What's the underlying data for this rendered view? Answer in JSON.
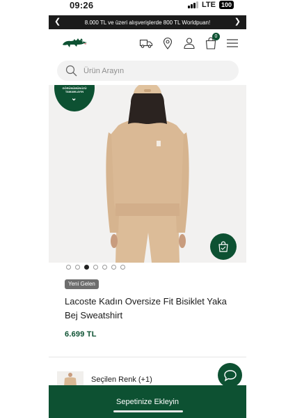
{
  "status_bar": {
    "time": "09:26",
    "network": "LTE",
    "battery": "100"
  },
  "announcement": {
    "text": "8.000 TL ve üzeri alışverişlerde 800 TL Worldpuan!",
    "prev_icon": "chevron-left-icon",
    "next_icon": "chevron-right-icon"
  },
  "header": {
    "logo": "lacoste-crocodile-logo",
    "icons": [
      "delivery-truck-icon",
      "location-pin-icon",
      "user-icon",
      "shopping-bag-icon",
      "menu-icon"
    ],
    "cart_count": "0"
  },
  "search": {
    "placeholder": "Ürün Arayın"
  },
  "gallery": {
    "complete_look_label": "GÖRÜNÜMÜNÜZÜ TAMAMLAYIN",
    "similar_icon": "similar-products-bag-icon",
    "image_count": 7,
    "active_index": 2
  },
  "product": {
    "badge": "Yeni Gelen",
    "title": "Lacoste Kadın Oversize Fit Bisiklet Yaka Bej Sweatshirt",
    "price": "6.699 TL"
  },
  "color_selector": {
    "label": "Seçilen Renk (+1)"
  },
  "chat": {
    "icon": "chat-bubble-icon"
  },
  "cta": {
    "label": "Sepetinize Ekleyin"
  },
  "colors": {
    "brand_green": "#0d5132",
    "announcement_bg": "#1b1b1b",
    "badge_bg": "#6d6d6d",
    "product_beige": "#d9b894"
  }
}
